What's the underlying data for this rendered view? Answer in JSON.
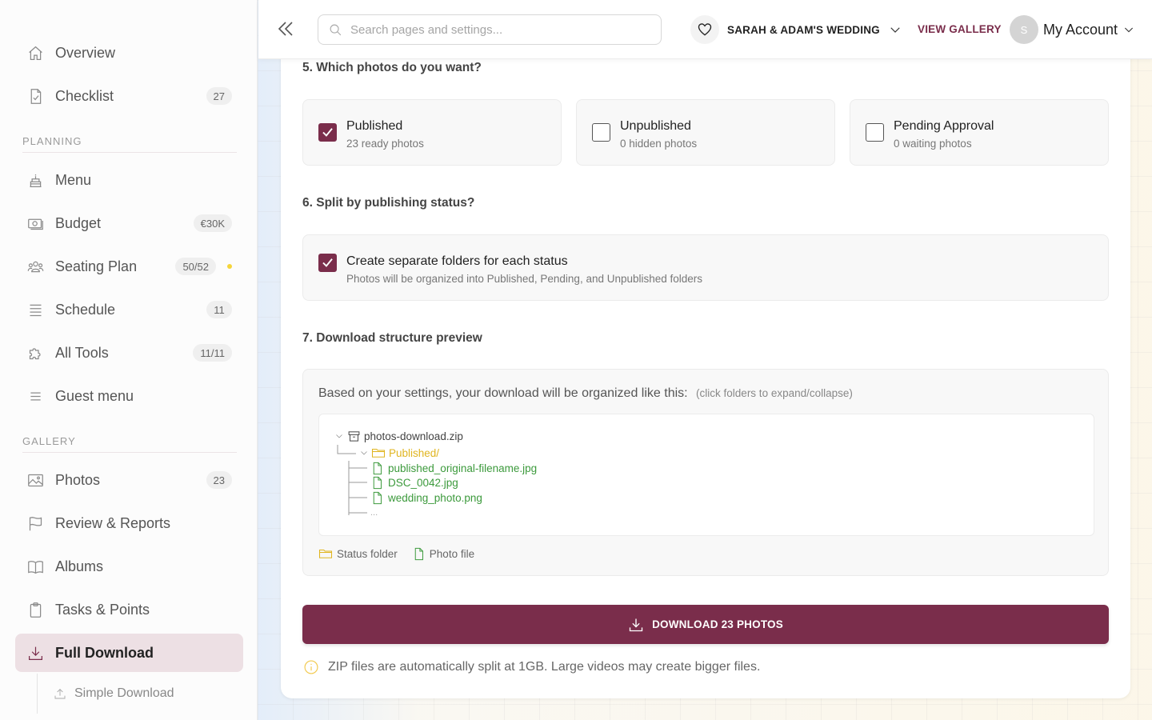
{
  "sidebar": {
    "items": [
      {
        "label": "Overview",
        "icon": "home-icon"
      },
      {
        "label": "Checklist",
        "icon": "checklist-icon",
        "badge": "27"
      },
      {
        "label": "Menu",
        "icon": "cake-icon"
      },
      {
        "label": "Budget",
        "icon": "money-icon",
        "badge": "€30K"
      },
      {
        "label": "Seating Plan",
        "icon": "users-icon",
        "badge": "50/52"
      },
      {
        "label": "Schedule",
        "icon": "list-icon",
        "badge": "11"
      },
      {
        "label": "All Tools",
        "icon": "puzzle-icon",
        "badge": "11/11"
      },
      {
        "label": "Guest menu",
        "icon": "menu-lines-icon"
      },
      {
        "label": "Photos",
        "icon": "image-icon",
        "badge": "23"
      },
      {
        "label": "Review & Reports",
        "icon": "flag-icon"
      },
      {
        "label": "Albums",
        "icon": "book-icon"
      },
      {
        "label": "Tasks & Points",
        "icon": "clipboard-icon"
      },
      {
        "label": "Full Download",
        "icon": "download-icon",
        "active": true
      },
      {
        "label": "Simple Download",
        "icon": "upload-icon"
      }
    ],
    "sections": {
      "planning": "PLANNING",
      "gallery": "GALLERY"
    }
  },
  "header": {
    "search_placeholder": "Search pages and settings...",
    "event_name": "SARAH & ADAM'S WEDDING",
    "view_gallery": "VIEW GALLERY",
    "avatar_initial": "S",
    "account_label": "My Account"
  },
  "main": {
    "q5": "5. Which photos do you want?",
    "options": [
      {
        "title": "Published",
        "subtitle": "23 ready photos",
        "checked": true
      },
      {
        "title": "Unpublished",
        "subtitle": "0 hidden photos",
        "checked": false
      },
      {
        "title": "Pending Approval",
        "subtitle": "0 waiting photos",
        "checked": false
      }
    ],
    "q6": "6. Split by publishing status?",
    "split": {
      "title": "Create separate folders for each status",
      "subtitle": "Photos will be organized into Published, Pending, and Unpublished folders",
      "checked": true
    },
    "q7": "7. Download structure preview",
    "preview": {
      "intro": "Based on your settings, your download will be organized like this:",
      "hint": "(click folders to expand/collapse)",
      "zip": "photos-download.zip",
      "folder": "Published/",
      "files": [
        "published_original-filename.jpg",
        "DSC_0042.jpg",
        "wedding_photo.png"
      ],
      "more": "...",
      "legend_folder": "Status folder",
      "legend_file": "Photo file"
    },
    "download_button": "DOWNLOAD 23 PHOTOS",
    "note": "ZIP files are automatically split at 1GB. Large videos may create bigger files."
  },
  "colors": {
    "accent": "#7a2d4b",
    "folder": "#e0b520",
    "file": "#3c9a3c",
    "note_icon": "#f2c94c"
  }
}
